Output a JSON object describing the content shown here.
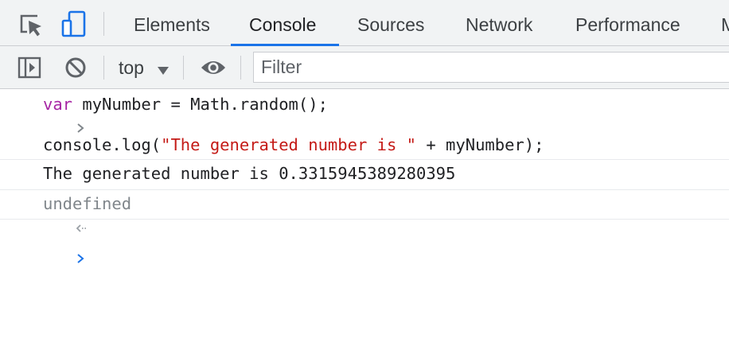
{
  "tabs": [
    {
      "label": "Elements"
    },
    {
      "label": "Console"
    },
    {
      "label": "Sources"
    },
    {
      "label": "Network"
    },
    {
      "label": "Performance"
    },
    {
      "label": "M"
    }
  ],
  "active_tab": "Console",
  "toolbar": {
    "context": "top",
    "filter_placeholder": "Filter"
  },
  "console": {
    "input1": {
      "keyword": "var",
      "rest": " myNumber = Math.random();"
    },
    "input2": {
      "pre": "console.log(",
      "string": "\"The generated number is \"",
      "post": " + myNumber);"
    },
    "log": "The generated number is 0.3315945389280395",
    "result": "undefined"
  },
  "colors": {
    "accent": "#1a73e8",
    "keyword": "#a626a4",
    "string": "#c41a16",
    "prompt": "#1a73e8",
    "muted": "#80868b",
    "toolbar_bg": "#f1f3f4"
  }
}
